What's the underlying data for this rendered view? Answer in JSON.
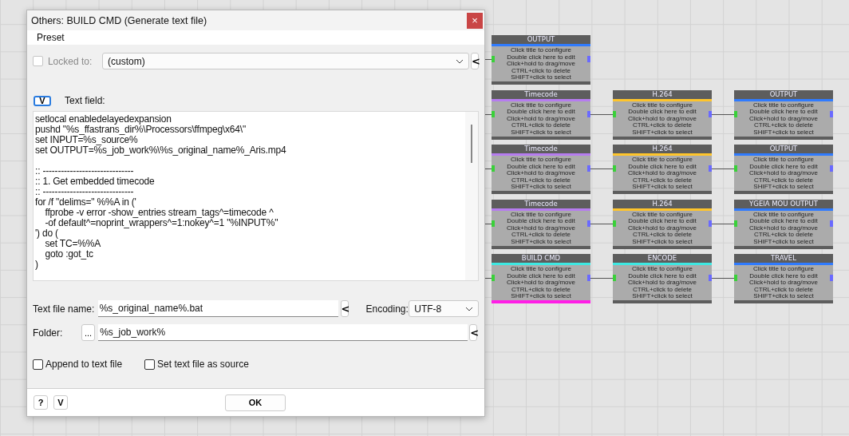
{
  "canvas": {
    "rows": [
      [
        {
          "title": "OUTPUT",
          "color": "#2f7bff",
          "selected": false,
          "lines": [
            "Click title to configure",
            "Double click here to edit",
            "Click+hold to drag/move",
            "CTRL+click to delete",
            "SHIFT+click to select"
          ]
        }
      ],
      [
        {
          "title": "Timecode",
          "color": "#b67cf0",
          "selected": false,
          "lines": [
            "Click title to configure",
            "Double click here to edit",
            "Click+hold to drag/move",
            "CTRL+click to delete",
            "SHIFT+click to select"
          ]
        },
        {
          "title": "H.264",
          "color": "#ffc52b",
          "selected": false,
          "lines": [
            "Click title to configure",
            "Double click here to edit",
            "Click+hold to drag/move",
            "CTRL+click to delete",
            "SHIFT+click to select"
          ]
        },
        {
          "title": "OUTPUT",
          "color": "#2f7bff",
          "selected": false,
          "lines": [
            "Click title to configure",
            "Double click here to edit",
            "Click+hold to drag/move",
            "CTRL+click to delete",
            "SHIFT+click to select"
          ]
        }
      ],
      [
        {
          "title": "Timecode",
          "color": "#b67cf0",
          "selected": false,
          "lines": [
            "Click title to configure",
            "Double click here to edit",
            "Click+hold to drag/move",
            "CTRL+click to delete",
            "SHIFT+click to select"
          ]
        },
        {
          "title": "H.264",
          "color": "#ffc52b",
          "selected": false,
          "lines": [
            "Click title to configure",
            "Double click here to edit",
            "Click+hold to drag/move",
            "CTRL+click to delete",
            "SHIFT+click to select"
          ]
        },
        {
          "title": "OUTPUT",
          "color": "#2f7bff",
          "selected": false,
          "lines": [
            "Click title to configure",
            "Double click here to edit",
            "Click+hold to drag/move",
            "CTRL+click to delete",
            "SHIFT+click to select"
          ]
        }
      ],
      [
        {
          "title": "Timecode",
          "color": "#b67cf0",
          "selected": false,
          "lines": [
            "Click title to configure",
            "Double click here to edit",
            "Click+hold to drag/move",
            "CTRL+click to delete",
            "SHIFT+click to select"
          ]
        },
        {
          "title": "H.264",
          "color": "#ffc52b",
          "selected": false,
          "lines": [
            "Click title to configure",
            "Double click here to edit",
            "Click+hold to drag/move",
            "CTRL+click to delete",
            "SHIFT+click to select"
          ]
        },
        {
          "title": "YGEIA  MOU  OUTPUT",
          "color": "#2f7bff",
          "selected": false,
          "lines": [
            "Click title to configure",
            "Double click here to edit",
            "Click+hold to drag/move",
            "CTRL+click to delete",
            "SHIFT+click to select"
          ]
        }
      ],
      [
        {
          "title": "BUILD CMD",
          "color": "#3ee8e2",
          "selected": true,
          "lines": [
            "Click title to configure",
            "Double click here to edit",
            "Click+hold to drag/move",
            "CTRL+click to delete",
            "SHIFT+click to select"
          ]
        },
        {
          "title": "ENCODE",
          "color": "#3ee8e2",
          "selected": false,
          "lines": [
            "Click title to configure",
            "Double click here to edit",
            "Click+hold to drag/move",
            "CTRL+click to delete",
            "SHIFT+click to select"
          ]
        },
        {
          "title": "TRAVEL",
          "color": "#2f7bff",
          "selected": false,
          "lines": [
            "Click title to configure",
            "Double click here to edit",
            "Click+hold to drag/move",
            "CTRL+click to delete",
            "SHIFT+click to select"
          ]
        }
      ]
    ]
  },
  "dialog": {
    "title": "Others: BUILD CMD (Generate text file)",
    "close": "×",
    "menu": [
      "Preset"
    ],
    "locked": {
      "label": "Locked to:",
      "checked": false,
      "disabled": true,
      "value": "(custom)",
      "arrow": "<"
    },
    "text_field": {
      "toggle": "V",
      "label": "Text field:",
      "blocks": [
        [
          "setlocal enabledelayedexpansion",
          "pushd \"%s_ffastrans_dir%\\Processors\\ffmpeg\\x64\\\"",
          "set INPUT=%s_source%",
          "set OUTPUT=%s_job_work%\\%s_original_name%_Aris.mp4"
        ],
        [
          ":: ------------------------------",
          ":: 1. Get embedded timecode",
          ":: ------------------------------",
          "for /f \"delims=\" %%A in ('",
          "    ffprobe -v error -show_entries stream_tags^=timecode ^",
          "    -of default^=noprint_wrappers^=1:nokey^=1 \"%INPUT%\"",
          "') do (",
          "    set TC=%%A",
          "    goto :got_tc",
          ")"
        ]
      ]
    },
    "file_name": {
      "label": "Text file name:",
      "value": "%s_original_name%.bat",
      "arrow": "<"
    },
    "encoding": {
      "label": "Encoding:",
      "value": "UTF-8"
    },
    "folder": {
      "label": "Folder:",
      "browse": "...",
      "value": "%s_job_work%",
      "arrow": "<"
    },
    "checkboxes": [
      {
        "label": "Append to text file",
        "checked": false
      },
      {
        "label": "Set text file as source",
        "checked": false
      }
    ],
    "footer": {
      "help": "?",
      "toggle": "V",
      "ok": "OK"
    }
  }
}
